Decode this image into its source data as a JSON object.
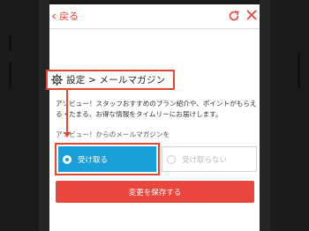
{
  "nav": {
    "back_label": "戻る",
    "back_icon": "chevron-left-icon",
    "refresh_icon": "refresh-icon",
    "close_icon": "close-icon"
  },
  "breadcrumb": {
    "icon": "gear-icon",
    "text": "設定 > メールマガジン"
  },
  "intro": {
    "text": "アソビュー！スタッフおすすめのプラン紹介や、ポイントがもらえる・たまる、お得な情報をタイムリーにお届けします。"
  },
  "subscription": {
    "label": "アソビュー！からのメールマガジンを",
    "selected": "受け取る",
    "options": [
      "受け取る",
      "受け取らない"
    ]
  },
  "save_button": {
    "label": "変更を保存する"
  },
  "colors": {
    "accent": "#e8453c",
    "selected": "#1a9fd8",
    "annotation": "#e3492f",
    "frame": "#1b1b1b"
  }
}
